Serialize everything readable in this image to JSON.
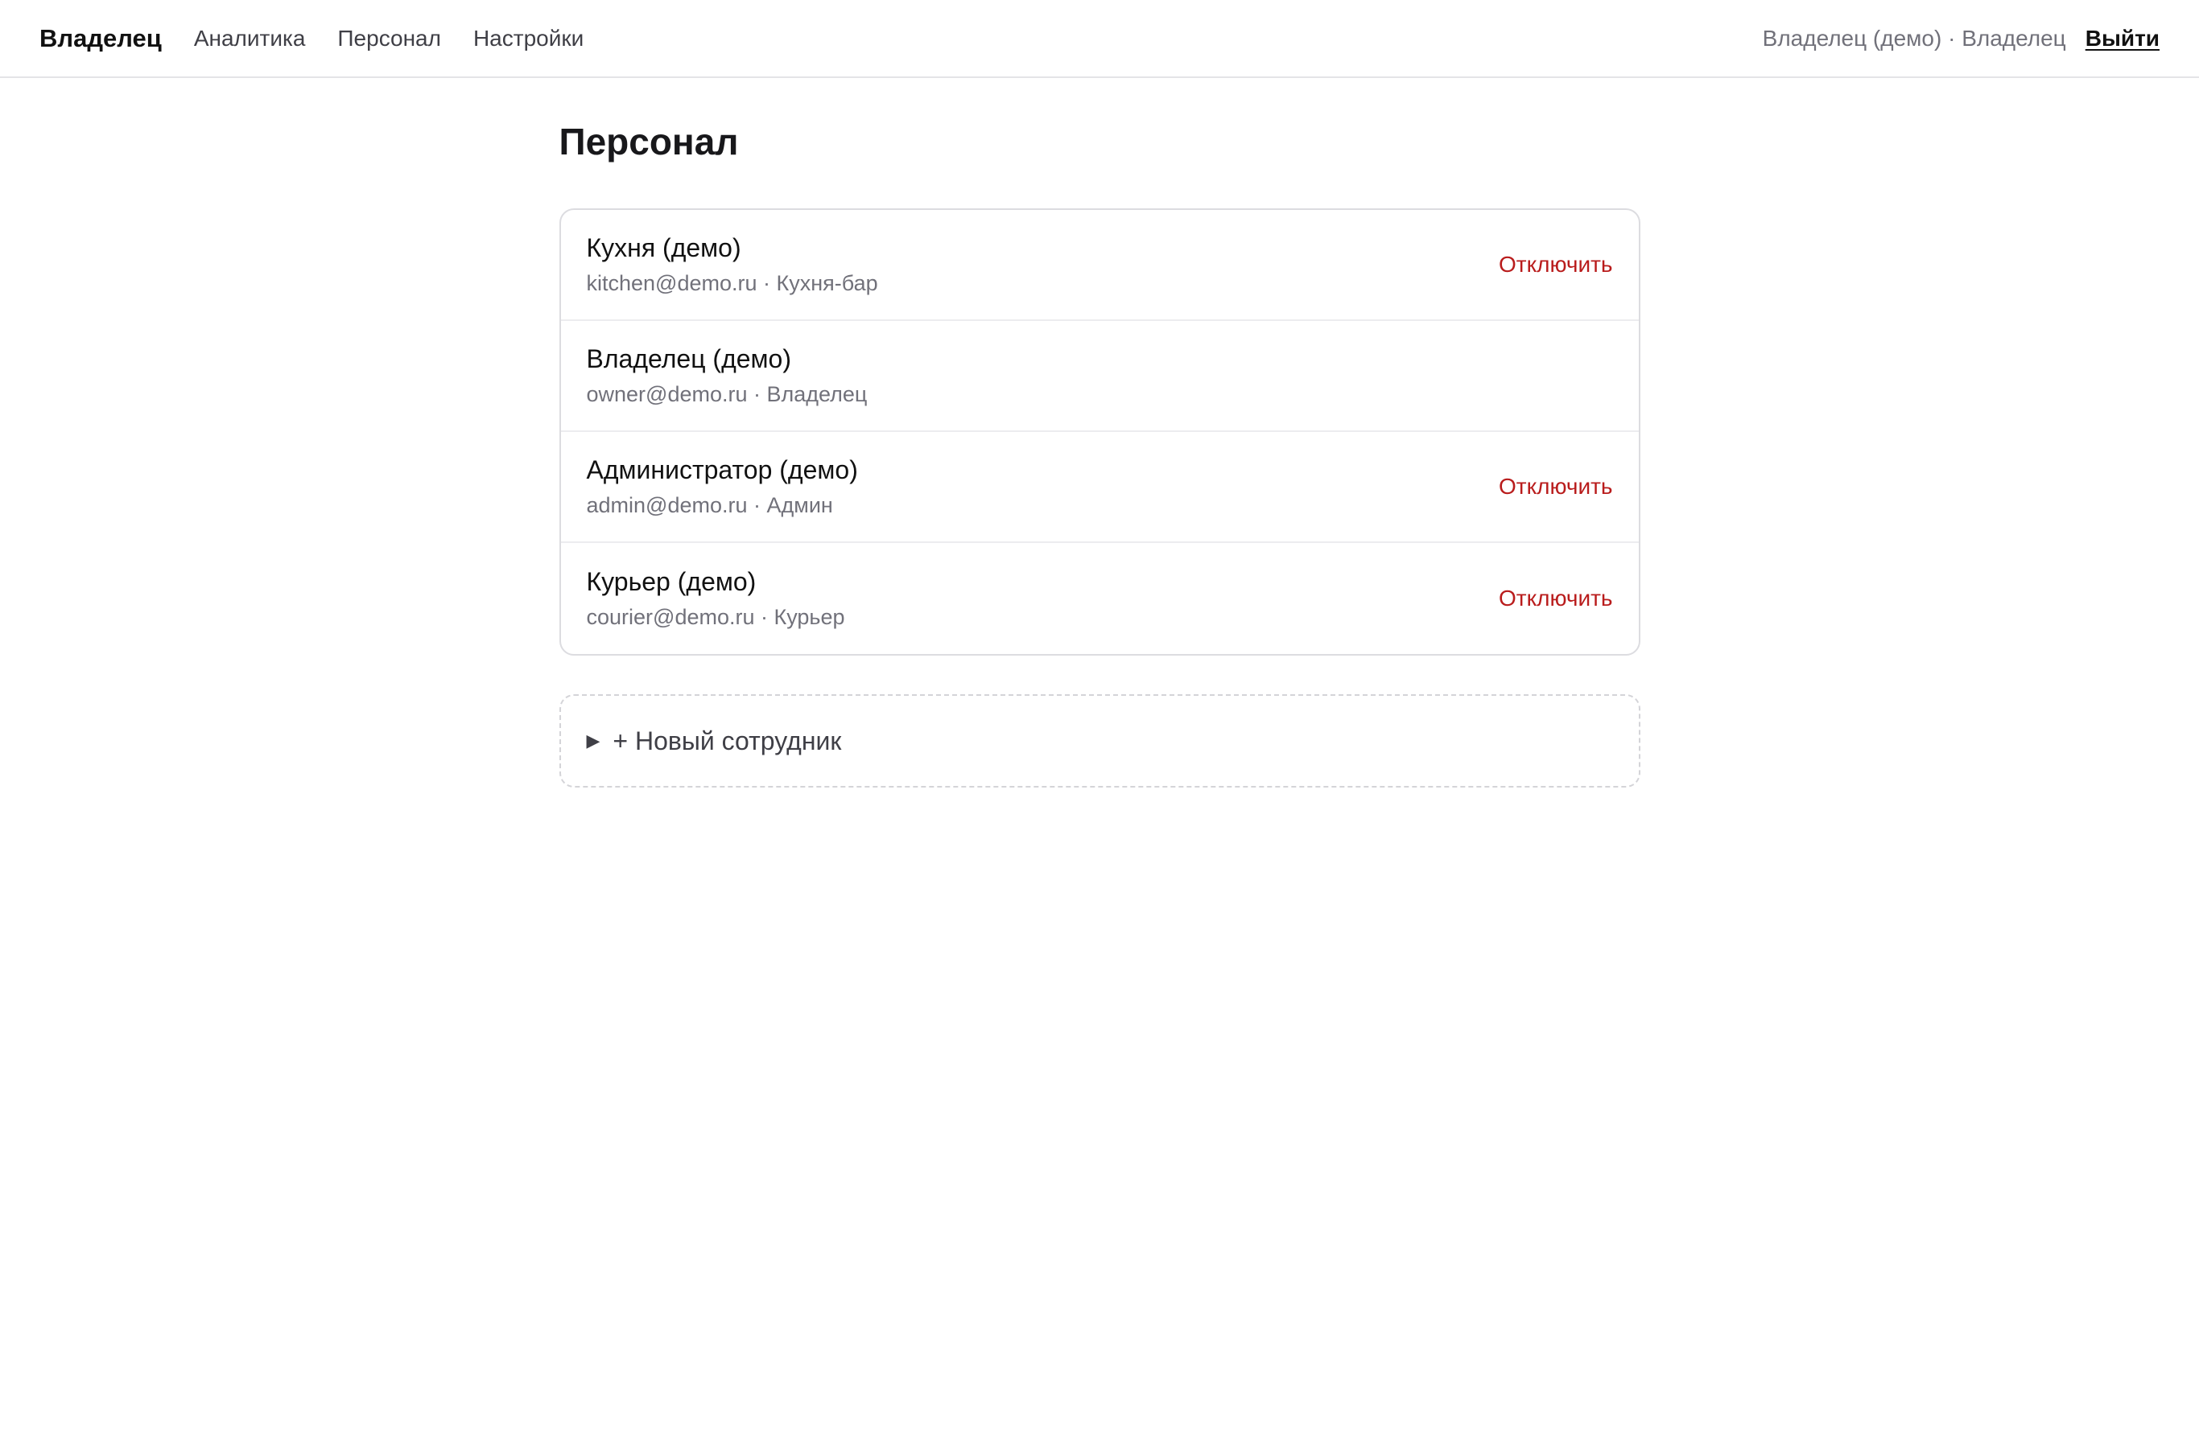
{
  "header": {
    "brand": "Владелец",
    "nav": [
      "Аналитика",
      "Персонал",
      "Настройки"
    ],
    "user_info": "Владелец (демо) · Владелец",
    "logout": "Выйти"
  },
  "page": {
    "title": "Персонал"
  },
  "staff": [
    {
      "name": "Кухня (демо)",
      "meta": "kitchen@demo.ru · Кухня-бар",
      "action": "Отключить"
    },
    {
      "name": "Владелец (демо)",
      "meta": "owner@demo.ru · Владелец",
      "action": ""
    },
    {
      "name": "Администратор (демо)",
      "meta": "admin@demo.ru · Админ",
      "action": "Отключить"
    },
    {
      "name": "Курьер (демо)",
      "meta": "courier@demo.ru · Курьер",
      "action": "Отключить"
    }
  ],
  "new_employee": {
    "icon": "caret-right-icon",
    "label": "+ Новый сотрудник"
  },
  "colors": {
    "danger": "#b91c1c",
    "muted": "#71717a",
    "border": "#dcdce0"
  }
}
